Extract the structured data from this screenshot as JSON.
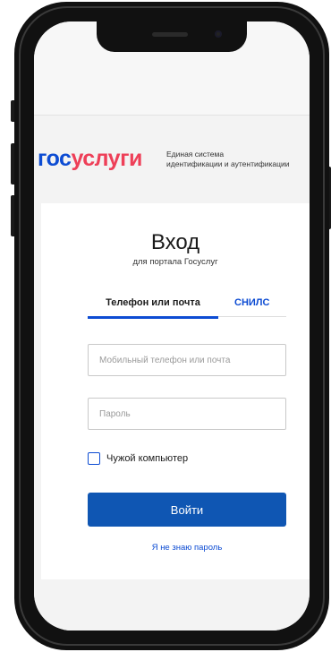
{
  "header": {
    "logo_part1": "гос",
    "logo_part2": "услуги",
    "subtitle_line1": "Единая система",
    "subtitle_line2": "идентификации и аутентификации"
  },
  "login": {
    "title": "Вход",
    "subtitle": "для портала Госуслуг",
    "tabs": [
      {
        "label": "Телефон или почта",
        "active": true
      },
      {
        "label": "СНИЛС",
        "active": false
      }
    ],
    "login_field": {
      "placeholder": "Мобильный телефон или почта",
      "value": ""
    },
    "password_field": {
      "placeholder": "Пароль",
      "value": ""
    },
    "checkbox": {
      "label": "Чужой компьютер",
      "checked": false
    },
    "submit_label": "Войти",
    "forgot_label": "Я не знаю пароль"
  },
  "colors": {
    "brand_blue": "#0d4cd3",
    "brand_red": "#ee3f58",
    "button_blue": "#0f56b3"
  }
}
